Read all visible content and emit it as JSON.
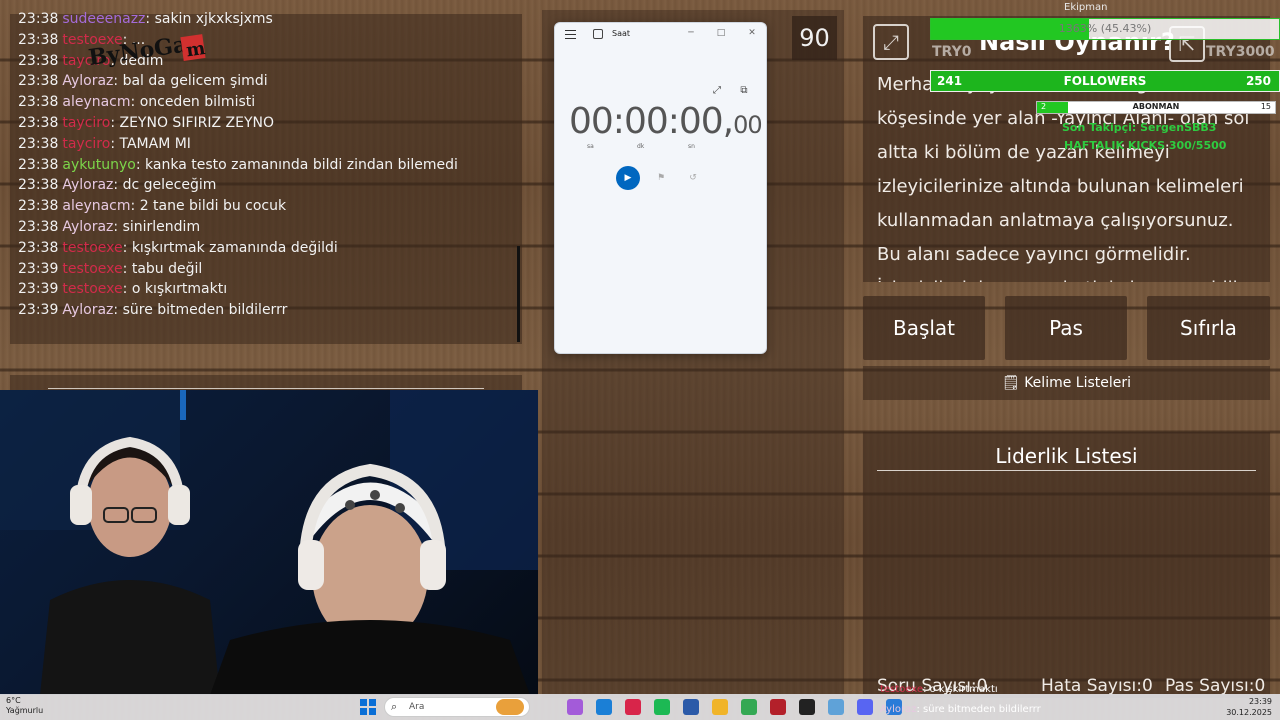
{
  "chat": {
    "messages": [
      {
        "time": "23:38",
        "user": "sudeeenazz",
        "color": "#a46bd9",
        "text": "sakin xjkxksjxms"
      },
      {
        "time": "23:38",
        "user": "testoexe",
        "color": "#d12b4a",
        "text": "..."
      },
      {
        "time": "23:38",
        "user": "tayciro",
        "color": "#d12b4a",
        "text": "dedim"
      },
      {
        "time": "23:38",
        "user": "Ayloraz",
        "color": "#e6c8e0",
        "text": "bal da gelicem şimdi"
      },
      {
        "time": "23:38",
        "user": "aleynacm",
        "color": "#e6c8e0",
        "text": "onceden bilmisti"
      },
      {
        "time": "23:38",
        "user": "tayciro",
        "color": "#d12b4a",
        "text": "ZEYNO SIFIRIZ ZEYNO"
      },
      {
        "time": "23:38",
        "user": "tayciro",
        "color": "#d12b4a",
        "text": "TAMAM MI"
      },
      {
        "time": "23:38",
        "user": "aykutunyo",
        "color": "#7cd64a",
        "text": "kanka testo zamanında bildi zindan bilemedi"
      },
      {
        "time": "23:38",
        "user": "Ayloraz",
        "color": "#e6c8e0",
        "text": "dc geleceğim"
      },
      {
        "time": "23:38",
        "user": "aleynacm",
        "color": "#e6c8e0",
        "text": "2 tane bildi bu cocuk"
      },
      {
        "time": "23:38",
        "user": "Ayloraz",
        "color": "#e6c8e0",
        "text": "sinirlendim"
      },
      {
        "time": "23:38",
        "user": "testoexe",
        "color": "#d12b4a",
        "text": "kışkırtmak zamanında değildi"
      },
      {
        "time": "23:39",
        "user": "testoexe",
        "color": "#d12b4a",
        "text": "tabu değil"
      },
      {
        "time": "23:39",
        "user": "testoexe",
        "color": "#d12b4a",
        "text": "o kışkırtmaktı"
      },
      {
        "time": "23:39",
        "user": "Ayloraz",
        "color": "#e6c8e0",
        "text": "süre bitmeden bildilerrr"
      }
    ]
  },
  "logo_text": "ByNoGam",
  "timer_count": "90",
  "clock_app": {
    "title": "Saat",
    "time_main": "00:00:00,",
    "time_ms": "00",
    "units": [
      "sa",
      "dk",
      "sn"
    ]
  },
  "info": {
    "title": "Nasıl Oynanır?",
    "text": "Merhaba, yayıncı. Ekranın sağ alt köşesinde yer alan -Yayıncı Alanı- olan sol altta ki bölüm de yazan kelimeyi izleyicilerinize altında bulunan kelimeleri kullanmadan anlatmaya çalışıyorsunuz. Bu alanı sadece yayıncı görmelidir. İzleyicileriniz yayın chatinizde cevap bilir..."
  },
  "controls": {
    "start": "Başlat",
    "pass": "Pas",
    "reset": "Sıfırla",
    "word_lists": "Kelime Listeleri"
  },
  "leaderboard": {
    "title": "Liderlik Listesi",
    "stats": [
      "Soru Sayısı:0",
      "Hata Sayısı:0",
      "Pas Sayısı:0"
    ]
  },
  "overlay": {
    "top_name": "Ekipman",
    "goal_text": "1363% (45.43%)",
    "goal_fraction": 0.4543,
    "try_left": "TRY0",
    "try_right": "TRY3000",
    "followers_current": "241",
    "followers_label": "FOLLOWERS",
    "followers_target": "250",
    "subs_current": "2",
    "subs_label": "ABONMAN",
    "subs_target": "15",
    "subs_fraction": 0.13,
    "last_follower": "Son Takipçi: SergenSBB3",
    "weekly_kicks": "HAFTALIK KICKS 300/5500",
    "chat_line1_user": "testoexe",
    "chat_line1_text": ": o kışkırtmaktı",
    "chat_line2_user": "Ayloraz",
    "chat_line2_text": ": süre bitmeden bildilerrr"
  },
  "taskbar": {
    "weather_temp": "6°C",
    "weather_desc": "Yağmurlu",
    "search_placeholder": "Ara",
    "time": "23:39",
    "date": "30.12.2025",
    "app_colors": [
      "#e9a03b",
      "#a35bd9",
      "#1b7fd6",
      "#d8254a",
      "#1db954",
      "#2b5aa8",
      "#f0b429",
      "#34a853",
      "#b3202a",
      "#222",
      "#5fa2d8",
      "#5865f2",
      "#2a7bd8"
    ]
  }
}
